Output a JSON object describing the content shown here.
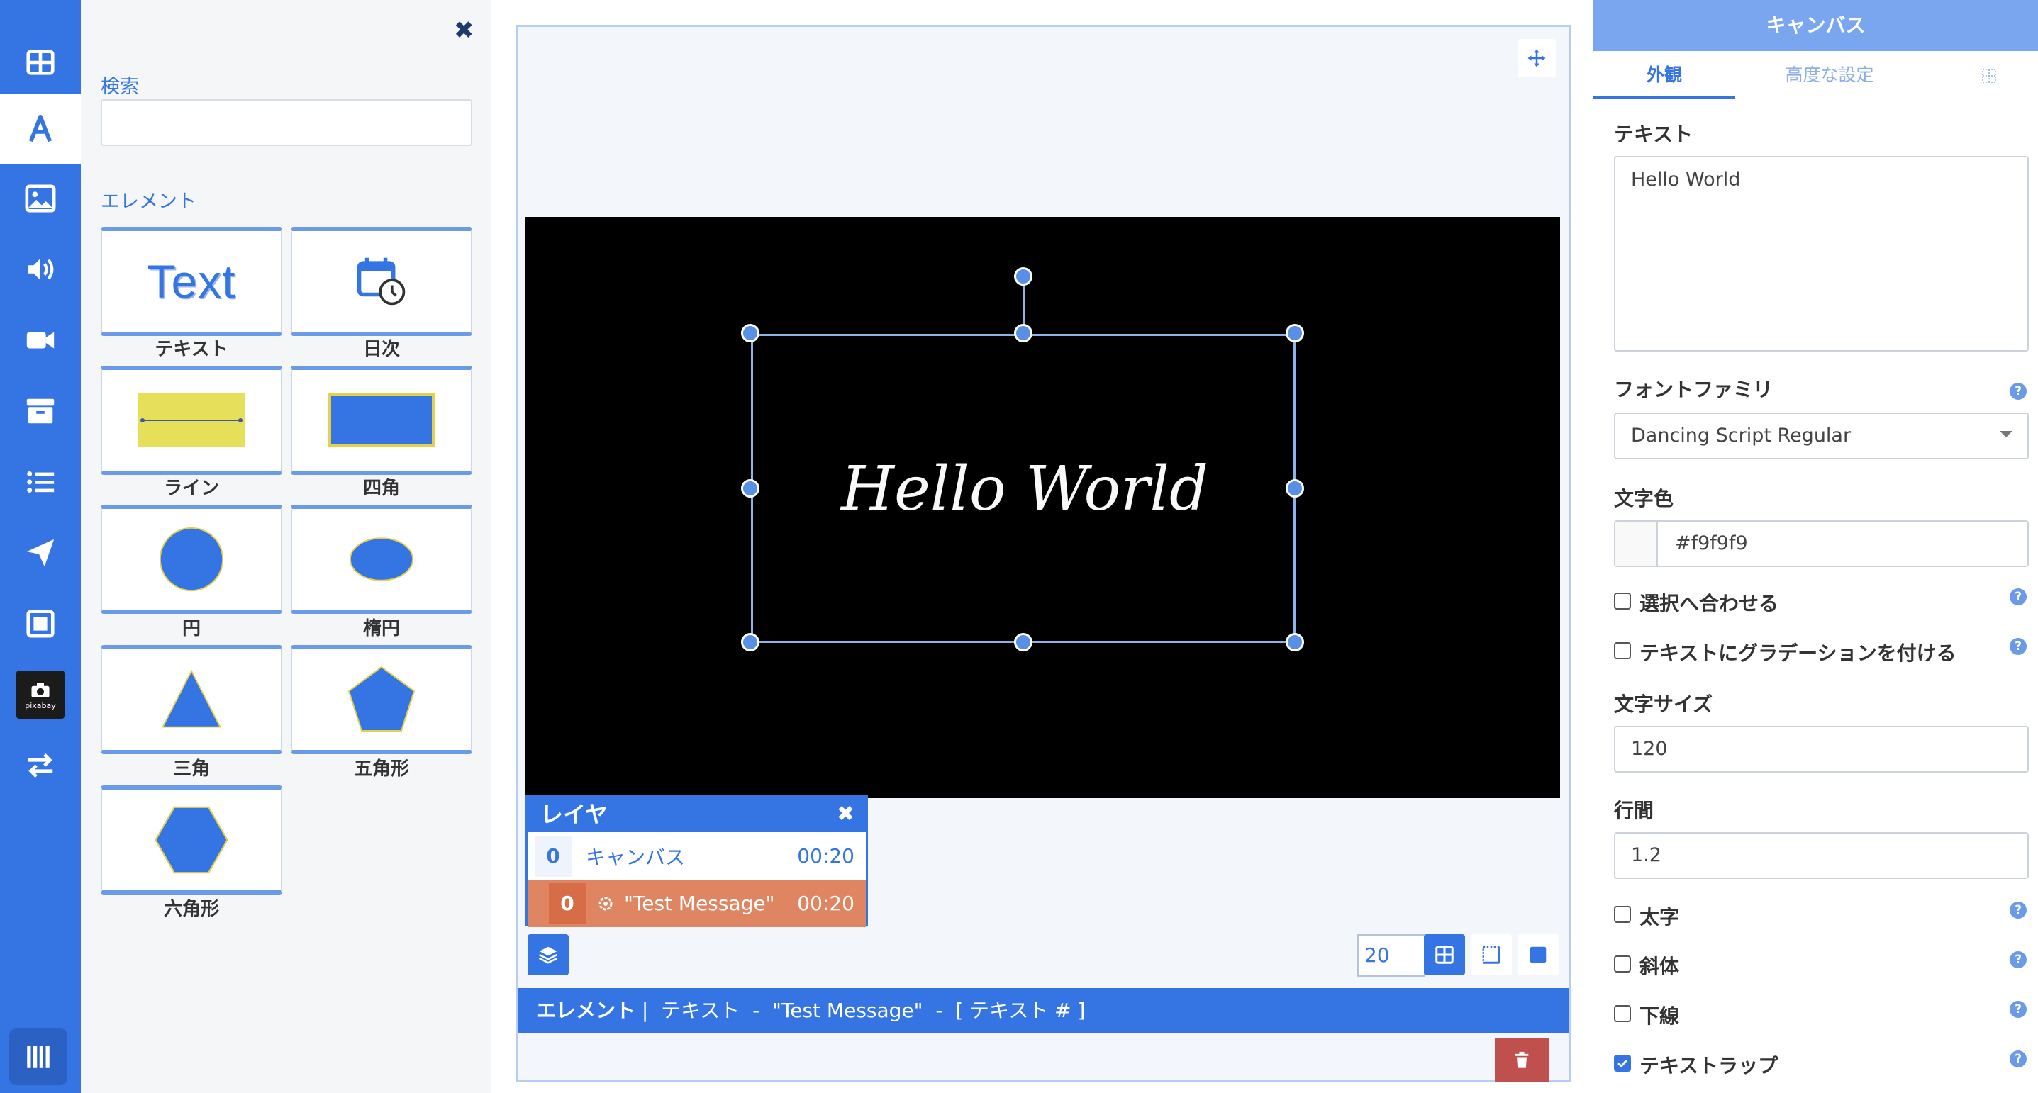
{
  "rail": {
    "items": [
      "layout-grid-icon",
      "text-icon",
      "image-icon",
      "audio-icon",
      "video-icon",
      "archive-icon",
      "list-icon",
      "send-icon",
      "frame-icon",
      "pixabay-icon",
      "transfer-icon",
      "library-icon"
    ],
    "pixabay_label": "pixabay",
    "accent": "#3575e3"
  },
  "panel": {
    "search_label": "検索",
    "search_value": "",
    "elements_label": "エレメント",
    "tiles": [
      {
        "label": "テキスト",
        "preview": "Text"
      },
      {
        "label": "日次"
      },
      {
        "label": "ライン"
      },
      {
        "label": "四角"
      },
      {
        "label": "円"
      },
      {
        "label": "楕円"
      },
      {
        "label": "三角"
      },
      {
        "label": "五角形"
      },
      {
        "label": "六角形"
      }
    ]
  },
  "canvas": {
    "text": "Hello World",
    "background": "#000000",
    "text_color": "#f9f9f9"
  },
  "layers": {
    "title": "レイヤ",
    "rows": [
      {
        "num": "0",
        "name": "キャンバス",
        "time": "00:20"
      },
      {
        "num": "0",
        "name": "\"Test Message\"",
        "time": "00:20"
      }
    ]
  },
  "toolbar": {
    "zoom": "20"
  },
  "status": {
    "prefix": "エレメント",
    "path": " |  テキスト  -  \"Test Message\"  -  [ テキスト # ]"
  },
  "props": {
    "header": "キャンバス",
    "tabs": [
      "外観",
      "高度な設定"
    ],
    "text_label": "テキスト",
    "text_value": "Hello World",
    "font_label": "フォントファミリ",
    "font_value": "Dancing Script Regular",
    "color_label": "文字色",
    "color_value": "#f9f9f9",
    "fit_selection": {
      "label": "選択へ合わせる",
      "checked": false
    },
    "gradient": {
      "label": "テキストにグラデーションを付ける",
      "checked": false
    },
    "size_label": "文字サイズ",
    "size_value": "120",
    "line_label": "行間",
    "line_value": "1.2",
    "bold": {
      "label": "太字",
      "checked": false
    },
    "italic": {
      "label": "斜体",
      "checked": false
    },
    "underline": {
      "label": "下線",
      "checked": false
    },
    "wrap": {
      "label": "テキストラップ",
      "checked": true
    }
  }
}
